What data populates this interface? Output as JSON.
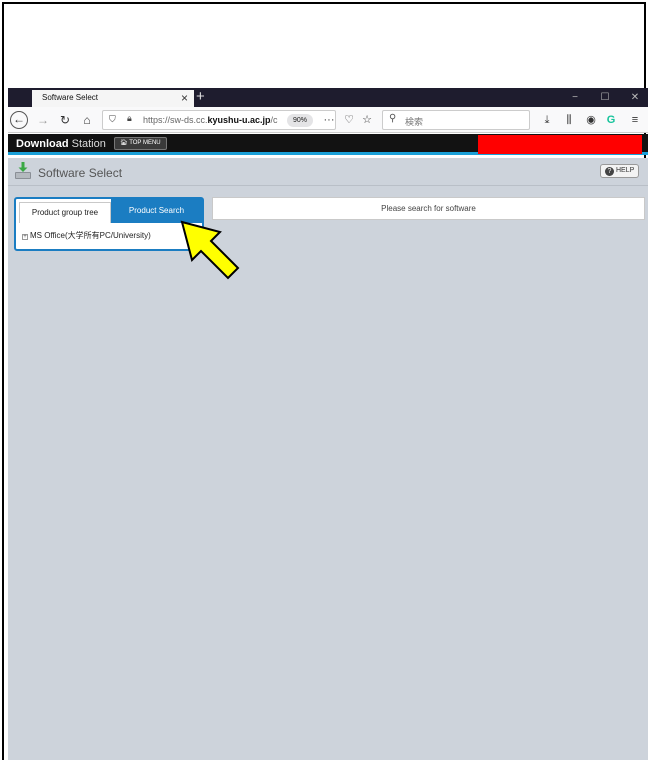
{
  "browser": {
    "tab_title": "Software Select",
    "tab_close": "×",
    "new_tab": "+",
    "window_controls": [
      "−",
      "☐",
      "✕"
    ],
    "url_prefix": "https://sw-ds.cc.",
    "url_domain": "kyushu-u.ac.jp",
    "url_suffix": "/c",
    "zoom": "90%",
    "search_placeholder": "検索",
    "icons": [
      "back-icon",
      "forward-icon",
      "reload-icon",
      "home-icon",
      "shield-icon",
      "lock-icon",
      "page-actions-icon",
      "pocket-icon",
      "bookmark-star-icon",
      "search-icon",
      "downloads-icon",
      "library-icon",
      "account-icon",
      "grammarly-icon",
      "hamburger-menu-icon"
    ]
  },
  "app": {
    "logo_bold": "Download",
    "logo_rest": " Station",
    "top_menu": "TOP MENU",
    "page_title": "Software Select",
    "help": "HELP"
  },
  "panel": {
    "tab_product_group": "Product group tree",
    "tab_product_search": "Product Search",
    "tree_item": "MS Office(大学所有PC/University)",
    "tree_expander": "+"
  },
  "main": {
    "message": "Please search for software"
  },
  "colors": {
    "accent": "#1b7dc2",
    "header_bg": "#121212",
    "content_bg": "#cdd3db",
    "redaction": "#ff0000",
    "annotation_arrow": "#ffff00"
  }
}
